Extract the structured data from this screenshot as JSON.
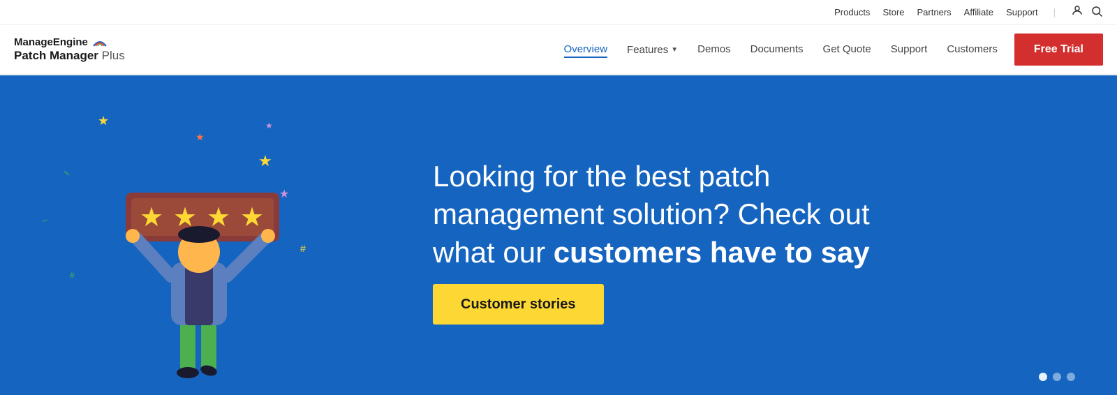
{
  "topBar": {
    "links": [
      {
        "label": "Products",
        "name": "products-link"
      },
      {
        "label": "Store",
        "name": "store-link"
      },
      {
        "label": "Partners",
        "name": "partners-link"
      },
      {
        "label": "Affiliate",
        "name": "affiliate-link"
      },
      {
        "label": "Support",
        "name": "support-link"
      }
    ]
  },
  "logo": {
    "manage": "Manage",
    "engine": "Engine",
    "patchManager": "Patch Manager",
    "plus": " Plus"
  },
  "nav": {
    "links": [
      {
        "label": "Overview",
        "active": true,
        "name": "nav-overview"
      },
      {
        "label": "Features",
        "active": false,
        "hasDropdown": true,
        "name": "nav-features"
      },
      {
        "label": "Demos",
        "active": false,
        "name": "nav-demos"
      },
      {
        "label": "Documents",
        "active": false,
        "name": "nav-documents"
      },
      {
        "label": "Get Quote",
        "active": false,
        "name": "nav-getquote"
      },
      {
        "label": "Support",
        "active": false,
        "name": "nav-support"
      },
      {
        "label": "Customers",
        "active": false,
        "name": "nav-customers"
      }
    ],
    "freeTrial": "Free Trial"
  },
  "hero": {
    "headline_part1": "Looking for the best patch",
    "headline_part2": "management solution? Check out",
    "headline_part3": "what our ",
    "headline_bold": "customers have to say",
    "ctaButton": "Customer stories",
    "colors": {
      "bg": "#1565c0",
      "cta": "#fdd835"
    }
  },
  "carousel": {
    "dots": [
      {
        "active": true
      },
      {
        "active": false
      },
      {
        "active": false
      }
    ]
  },
  "icons": {
    "user": "👤",
    "search": "🔍",
    "caret": "▼"
  }
}
